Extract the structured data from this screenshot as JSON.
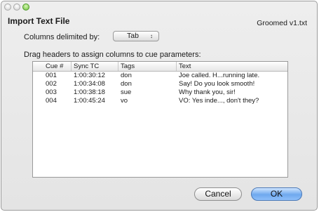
{
  "dialog": {
    "title": "Import Text File",
    "filename": "Groomed v1.txt"
  },
  "delimiter": {
    "label": "Columns delimited by:",
    "value": "Tab",
    "arrows": "↕"
  },
  "instruction": "Drag headers to assign columns to cue parameters:",
  "table": {
    "headers": [
      "Cue #",
      "Sync TC",
      "Tags",
      "Text"
    ],
    "rows": [
      [
        "001",
        "1:00:30:12",
        "don",
        "Joe called. H...running late."
      ],
      [
        "002",
        "1:00:34:08",
        "don",
        "Say! Do you look smooth!"
      ],
      [
        "003",
        "1:00:38:18",
        "sue",
        "Why thank you, sir!"
      ],
      [
        "004",
        "1:00:45:24",
        "vo",
        "VO: Yes inde..., don't they?"
      ]
    ]
  },
  "buttons": {
    "cancel": "Cancel",
    "ok": "OK"
  },
  "colors": {
    "default_button": "#6ea8ee",
    "window_bg": "#e8e8e8"
  }
}
